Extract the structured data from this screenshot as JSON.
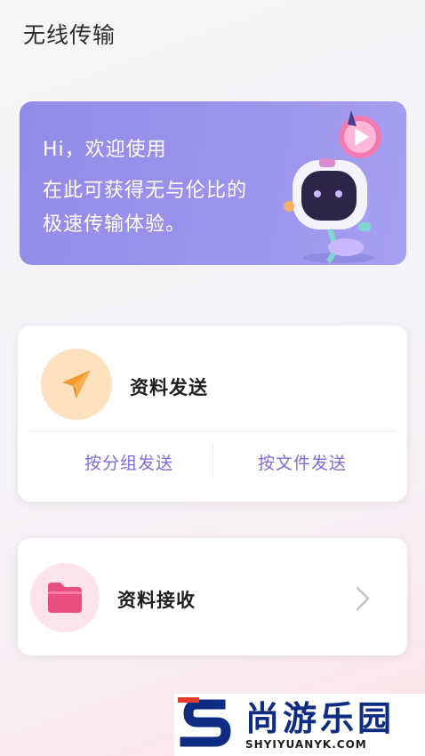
{
  "header": {
    "title": "无线传输"
  },
  "banner": {
    "greeting": "Hi，欢迎使用",
    "line1": "在此可获得无与伦比的",
    "line2": "极速传输体验。"
  },
  "send_card": {
    "title": "资料发送",
    "icon": "paper-plane-icon",
    "actions": [
      "按分组发送",
      "按文件发送"
    ]
  },
  "receive_card": {
    "title": "资料接收",
    "icon": "folder-icon"
  },
  "watermark": {
    "text": "尚游乐园",
    "url": "SHYIYUANYK.COM"
  },
  "colors": {
    "banner": "#9a94ec",
    "accent_purple": "#7b6fd8",
    "send_icon_bg": "#fde0be",
    "send_icon": "#f29a2e",
    "receive_icon_bg": "#fde3ea",
    "receive_icon": "#e84f7c"
  }
}
